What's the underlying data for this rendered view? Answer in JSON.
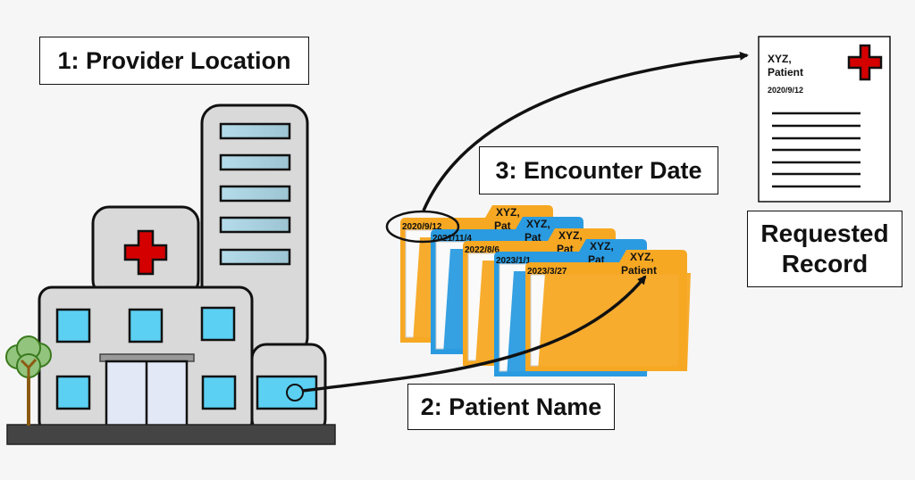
{
  "labels": {
    "provider_location": "1: Provider Location",
    "patient_name": "2: Patient Name",
    "encounter_date": "3: Encounter Date",
    "requested_record_line1": "Requested",
    "requested_record_line2": "Record"
  },
  "folders": [
    {
      "date": "2020/9/12",
      "name_line1": "XYZ,",
      "name_line2": "Pat",
      "color": "#f7a823"
    },
    {
      "date": "2021/11/4",
      "name_line1": "XYZ,",
      "name_line2": "Pat",
      "color": "#2a9be0"
    },
    {
      "date": "2022/8/6",
      "name_line1": "XYZ,",
      "name_line2": "Pat",
      "color": "#f7a823"
    },
    {
      "date": "2023/1/1",
      "name_line1": "XYZ,",
      "name_line2": "Pat",
      "color": "#2a9be0"
    },
    {
      "date": "2023/3/27",
      "name_line1": "XYZ,",
      "name_line2": "Patient",
      "color": "#f7a823"
    }
  ],
  "record": {
    "name_line1": "XYZ,",
    "name_line2": "Patient",
    "date": "2020/9/12"
  },
  "colors": {
    "cross": "#d40000",
    "window": "#5bd0f2",
    "building": "#d9d9d9"
  }
}
